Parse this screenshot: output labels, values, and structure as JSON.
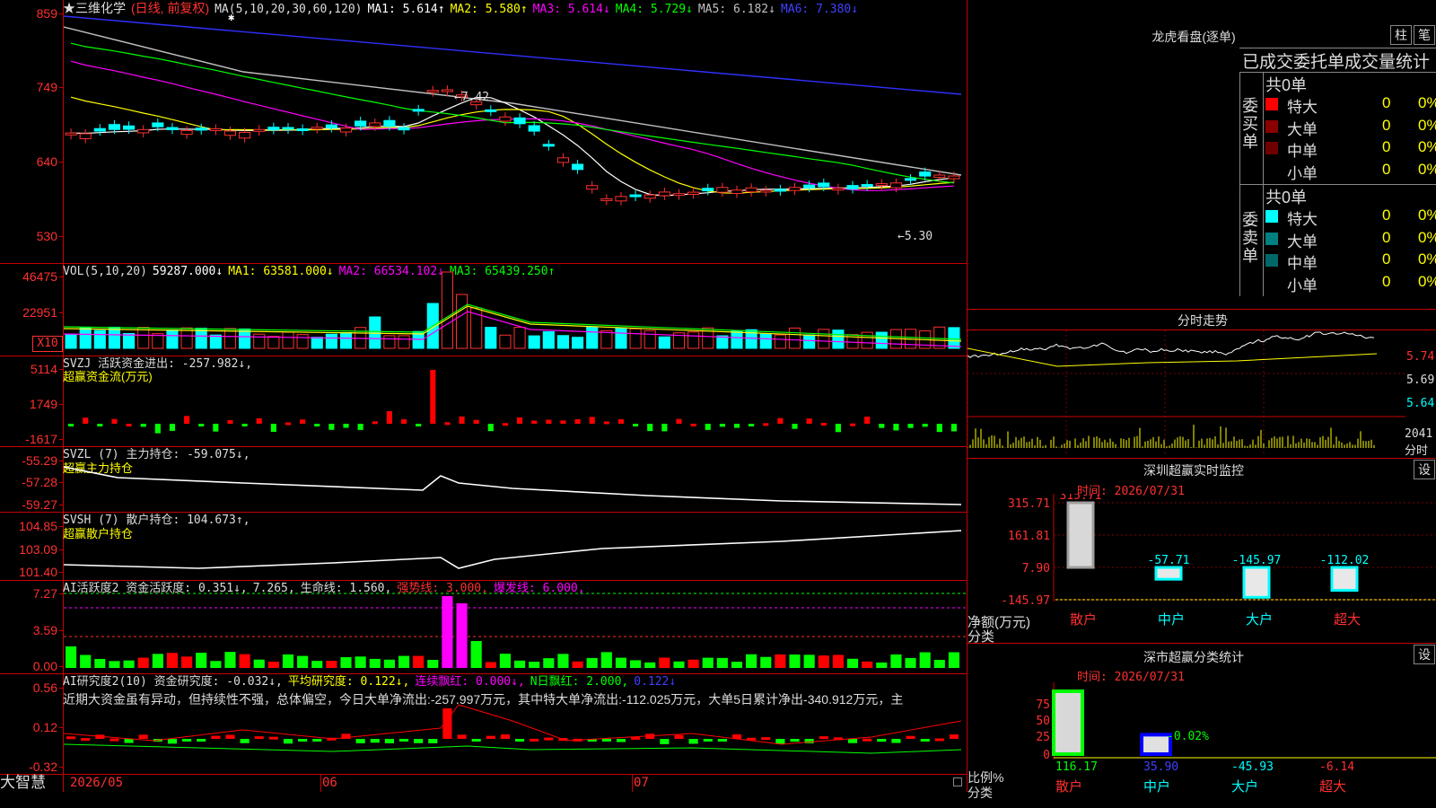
{
  "header": {
    "stock_name": "★三维化学",
    "mode": "(日线, 前复权)",
    "star": "✱",
    "ma_label": "MA(5,10,20,30,60,120)",
    "ma": [
      {
        "text": "MA1: 5.614↑",
        "color": "#ffffff"
      },
      {
        "text": "MA2: 5.580↑",
        "color": "#ffff00"
      },
      {
        "text": "MA3: 5.614↓",
        "color": "#ff00ff"
      },
      {
        "text": "MA4: 5.729↓",
        "color": "#00ff00"
      },
      {
        "text": "MA5: 6.182↓",
        "color": "#c0c0c0"
      },
      {
        "text": "MA6: 7.380↓",
        "color": "#4040ff"
      }
    ]
  },
  "price_axis": [
    "859",
    "749",
    "640",
    "530"
  ],
  "price_annotations": {
    "high": "←7.42",
    "low": "←5.30"
  },
  "vol_panel": {
    "label": "VOL(5,10,20)",
    "items": [
      {
        "text": "59287.000↓",
        "color": "#ffffff"
      },
      {
        "text": "MA1: 63581.000↓",
        "color": "#ffff00"
      },
      {
        "text": "MA2: 66534.102↓",
        "color": "#ff00ff"
      },
      {
        "text": "MA3: 65439.250↑",
        "color": "#00ff00"
      }
    ],
    "axis": [
      "46475",
      "22951"
    ],
    "unit": "X10"
  },
  "svzj_panel": {
    "label": "SVZJ  活跃资金进出: -257.982↓,",
    "sub": "超赢资金流(万元)",
    "axis": [
      "5114",
      "1749",
      "-1617"
    ]
  },
  "svzl_panel": {
    "label": "SVZL (7) 主力持仓: -59.075↓,",
    "sub": "超赢主力持仓",
    "axis": [
      "-55.29",
      "-57.28",
      "-59.27"
    ]
  },
  "svsh_panel": {
    "label": "SVSH (7) 散户持仓: 104.673↑,",
    "sub": "超赢散户持仓",
    "axis": [
      "104.85",
      "103.09",
      "101.40"
    ]
  },
  "ai_active_panel": {
    "items": [
      {
        "text": "AI活跃度2 资金活跃度: 0.351↓,",
        "color": "#dddddd"
      },
      {
        "text": "7.265,",
        "color": "#dddddd"
      },
      {
        "text": "生命线: 1.560,",
        "color": "#dddddd"
      },
      {
        "text": "强势线: 3.000,",
        "color": "#ff3030"
      },
      {
        "text": "爆发线: 6.000,",
        "color": "#ff00ff"
      }
    ],
    "axis": [
      "7.27",
      "3.59",
      "0.00"
    ]
  },
  "ai_research_panel": {
    "items": [
      {
        "text": "AI研究度2(10) 资金研究度: -0.032↓,",
        "color": "#dddddd"
      },
      {
        "text": "平均研究度: 0.122↓,",
        "color": "#ffff00"
      },
      {
        "text": "连续飘红: 0.000↓,",
        "color": "#ff00ff"
      },
      {
        "text": "N日飘红: 2.000,",
        "color": "#00ff00"
      },
      {
        "text": "0.122↓",
        "color": "#4040ff"
      }
    ],
    "note": "近期大资金虽有异动，但持续性不强，总体偏空，今日大单净流出:-257.997万元，其中特大单净流出:-112.025万元，大单5日累计净出-340.912万元，主",
    "axis": [
      "0.56",
      "0.12",
      "-0.32"
    ]
  },
  "date_axis": [
    "2026/05",
    "06",
    "07"
  ],
  "brand": "大智慧",
  "right_panel": {
    "lhb_title": "龙虎看盘(逐单)",
    "btn_bar": "柱",
    "btn_pen": "笔",
    "stat_title": "已成交委托单成交量统计",
    "buy_label": "委买单",
    "sell_label": "委卖单",
    "buy_total": "共0单",
    "sell_total": "共0单",
    "buy_rows": [
      {
        "label": "特大",
        "n": "0",
        "p": "0%",
        "color": "#ff0000"
      },
      {
        "label": "大单",
        "n": "0",
        "p": "0%",
        "color": "#8b0000"
      },
      {
        "label": "中单",
        "n": "0",
        "p": "0%",
        "color": "#700000"
      },
      {
        "label": "小单",
        "n": "0",
        "p": "0%",
        "color": "#000000"
      }
    ],
    "sell_rows": [
      {
        "label": "特大",
        "n": "0",
        "p": "0%",
        "color": "#00ffff"
      },
      {
        "label": "大单",
        "n": "0",
        "p": "0%",
        "color": "#008080"
      },
      {
        "label": "中单",
        "n": "0",
        "p": "0%",
        "color": "#006868"
      },
      {
        "label": "小单",
        "n": "0",
        "p": "0%",
        "color": "#000000"
      }
    ],
    "intraday_title": "分时走势",
    "intraday_axis": [
      "5.74",
      "5.69",
      "5.64"
    ],
    "intraday_vol": "2041",
    "intraday_vol_label": "分时",
    "monitor_title": "深圳超赢实时监控",
    "monitor_btn": "设",
    "monitor_time": "时间: 2026/07/31",
    "monitor_axis": [
      "315.71",
      "161.81",
      "7.90",
      "-145.97"
    ],
    "monitor_values": [
      {
        "label": "散户",
        "value": 315.71,
        "text": "315.71"
      },
      {
        "label": "中户",
        "value": -57.71,
        "text": "-57.71"
      },
      {
        "label": "大户",
        "value": -145.97,
        "text": "-145.97"
      },
      {
        "label": "超大",
        "value": -112.02,
        "text": "-112.02"
      }
    ],
    "monitor_unit": "净额(万元)",
    "monitor_cat": "分类",
    "class_title": "深市超赢分类统计",
    "class_btn": "设",
    "class_time": "时间: 2026/07/31",
    "class_axis": [
      "75",
      "50",
      "25",
      "0"
    ],
    "class_values": [
      {
        "label": "散户",
        "value": 116.17,
        "text": "116.17"
      },
      {
        "label": "中户",
        "value": 35.9,
        "text": "35.90"
      },
      {
        "label": "大户",
        "value": -45.93,
        "text": "-45.93"
      },
      {
        "label": "超大",
        "value": -6.14,
        "text": "-6.14"
      }
    ],
    "class_mid": "-0.02%",
    "class_unit": "比例%",
    "class_cat": "分类"
  }
}
